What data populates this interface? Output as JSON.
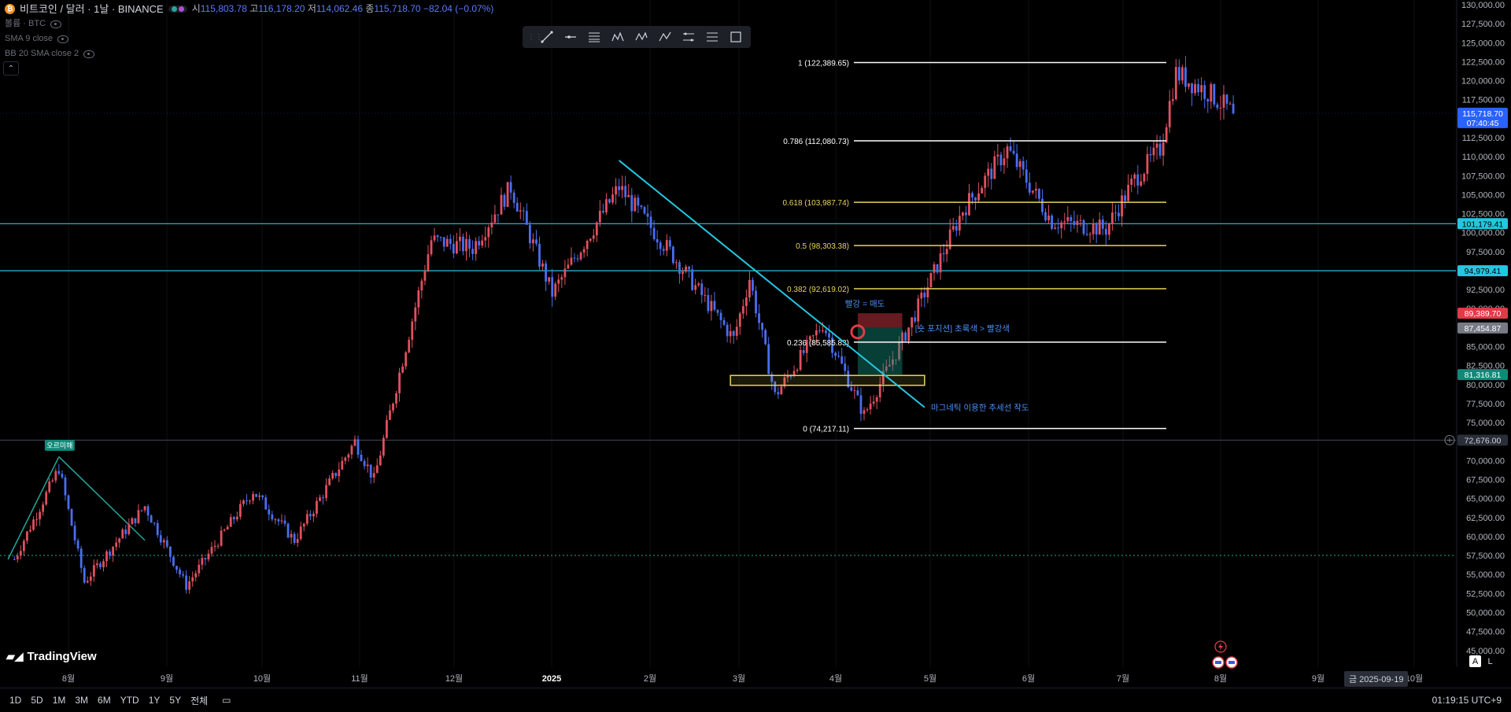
{
  "header": {
    "symbol_title": "비트코인 / 달러 · 1날 · BINANCE",
    "ohlc": [
      {
        "k": "시",
        "v": "115,803.78"
      },
      {
        "k": "고",
        "v": "116,178.20"
      },
      {
        "k": "저",
        "v": "114,062.46"
      },
      {
        "k": "종",
        "v": "115,718.70"
      }
    ],
    "change": "−82.04 (−0.07%)",
    "sub_label": "볼륨 · BTC",
    "indicators": [
      "SMA 9 close",
      "BB 20 SMA close 2"
    ]
  },
  "colors": {
    "bull": "#e05060",
    "bear": "#4a6ef0",
    "cyan": "#25c6e0",
    "fib_white": "#ffffff",
    "fib_yellow": "#e8d45a",
    "teal": "#26a69a",
    "annotation_blue": "#4a8ef5"
  },
  "toolbar": {
    "icons": [
      "trend-line-icon",
      "horizontal-ray-icon",
      "fib-retracement-icon",
      "pattern-icon",
      "xabcd-pattern-icon",
      "abcd-pattern-icon",
      "parallel-channel-icon",
      "fib-channel-icon",
      "rectangle-icon"
    ]
  },
  "chart_data": {
    "type": "candlestick",
    "x_ticks": [
      "8월",
      "9월",
      "10월",
      "11월",
      "12월",
      "2025",
      "2월",
      "3월",
      "4월",
      "5월",
      "6월",
      "7월",
      "8월",
      "9월",
      "10월"
    ],
    "y_ticks": [
      "130,000.00",
      "127,500.00",
      "125,000.00",
      "122,500.00",
      "120,000.00",
      "117,500.00",
      "115,000.00",
      "112,500.00",
      "110,000.00",
      "107,500.00",
      "105,000.00",
      "102,500.00",
      "100,000.00",
      "97,500.00",
      "95,000.00",
      "92,500.00",
      "90,000.00",
      "87,500.00",
      "85,000.00",
      "82,500.00",
      "80,000.00",
      "77,500.00",
      "75,000.00",
      "72,500.00",
      "70,000.00",
      "67,500.00",
      "65,000.00",
      "62,500.00",
      "60,000.00",
      "57,500.00",
      "55,000.00",
      "52,500.00",
      "50,000.00",
      "47,500.00",
      "45,000.00"
    ],
    "ylim": [
      43500,
      131000
    ],
    "price_path": [
      {
        "date": "2024-07-14",
        "price": 57000
      },
      {
        "date": "2024-07-28",
        "price": 69000
      },
      {
        "date": "2024-08-05",
        "price": 54000
      },
      {
        "date": "2024-08-24",
        "price": 64000
      },
      {
        "date": "2024-09-06",
        "price": 53500
      },
      {
        "date": "2024-09-27",
        "price": 66000
      },
      {
        "date": "2024-10-10",
        "price": 59500
      },
      {
        "date": "2024-10-29",
        "price": 72500
      },
      {
        "date": "2024-11-04",
        "price": 67500
      },
      {
        "date": "2024-11-22",
        "price": 99000
      },
      {
        "date": "2024-12-05",
        "price": 98000
      },
      {
        "date": "2024-12-17",
        "price": 106000
      },
      {
        "date": "2024-12-30",
        "price": 92000
      },
      {
        "date": "2025-01-20",
        "price": 106000
      },
      {
        "date": "2025-02-05",
        "price": 97500
      },
      {
        "date": "2025-02-25",
        "price": 86000
      },
      {
        "date": "2025-03-02",
        "price": 94000
      },
      {
        "date": "2025-03-10",
        "price": 78500
      },
      {
        "date": "2025-03-25",
        "price": 88000
      },
      {
        "date": "2025-04-07",
        "price": 76000
      },
      {
        "date": "2025-04-21",
        "price": 87500
      },
      {
        "date": "2025-05-08",
        "price": 103000
      },
      {
        "date": "2025-05-22",
        "price": 111000
      },
      {
        "date": "2025-06-05",
        "price": 101500
      },
      {
        "date": "2025-06-22",
        "price": 100500
      },
      {
        "date": "2025-07-01",
        "price": 107000
      },
      {
        "date": "2025-07-09",
        "price": 111000
      },
      {
        "date": "2025-07-14",
        "price": 121000
      },
      {
        "date": "2025-07-24",
        "price": 118500
      },
      {
        "date": "2025-08-01",
        "price": 115700
      }
    ],
    "horizontal_lines": [
      {
        "price": 101179.41,
        "label": "101,179.41",
        "color": "#25c6e0"
      },
      {
        "price": 94979.41,
        "label": "94,979.41",
        "color": "#25c6e0"
      },
      {
        "price": 72676.0,
        "label": "72,676.00",
        "color": "#3a3f4b"
      }
    ],
    "dotted_line": {
      "price": 57500
    },
    "price_labels": [
      {
        "price": 115718.7,
        "label": "115,718.70",
        "sub": "07:40:45",
        "color": "#2962ff"
      },
      {
        "price": 89389.7,
        "label": "89,389.70",
        "color": "#e03b46"
      },
      {
        "price": 87454.87,
        "label": "87,454.87",
        "color": "#787b86"
      },
      {
        "price": 81316.81,
        "label": "81,316.81",
        "color": "#0f8a78"
      }
    ],
    "fib": {
      "start_date": "2025-04-07",
      "end_date": "2025-07-14",
      "levels": [
        {
          "ratio": "1",
          "price": 122389.65,
          "label": "1 (122,389.65)",
          "color": "#ffffff"
        },
        {
          "ratio": "0.786",
          "price": 112080.73,
          "label": "0.786 (112,080.73)",
          "color": "#ffffff"
        },
        {
          "ratio": "0.618",
          "price": 103987.74,
          "label": "0.618 (103,987.74)",
          "color": "#e8d45a"
        },
        {
          "ratio": "0.5",
          "price": 98303.38,
          "label": "0.5 (98,303.38)",
          "color": "#e8d45a"
        },
        {
          "ratio": "0.382",
          "price": 92619.02,
          "label": "0.382 (92,619.02)",
          "color": "#e8d45a"
        },
        {
          "ratio": "0.236",
          "price": 85585.83,
          "label": "0.236 (85,585.83)",
          "color": "#ffffff"
        },
        {
          "ratio": "0",
          "price": 74217.11,
          "label": "0 (74,217.11)",
          "color": "#ffffff"
        }
      ]
    },
    "trendline": {
      "from": {
        "date": "2025-01-20",
        "price": 109500
      },
      "to": {
        "date": "2025-04-26",
        "price": 77000
      }
    },
    "zone": {
      "from_date": "2025-02-24",
      "to_date": "2025-04-26",
      "top": 81200,
      "bottom": 79900
    },
    "position": {
      "from_date": "2025-04-05",
      "to_date": "2025-04-19",
      "entry": 87454.87,
      "stop": 89389.7,
      "target": 81316.81
    },
    "uptrend_lines": [
      {
        "from": {
          "date": "2024-07-12",
          "price": 57000
        },
        "to": {
          "date": "2024-07-28",
          "price": 70500
        }
      },
      {
        "from": {
          "date": "2024-07-28",
          "price": 70500
        },
        "to": {
          "date": "2024-08-24",
          "price": 59500
        }
      }
    ],
    "annotations": [
      {
        "text": "빨강 = 매도",
        "date": "2025-04-01",
        "price": 90300
      },
      {
        "text": "[숏 포지션] 초록색 > 빨강색",
        "date": "2025-04-23",
        "price": 87000
      },
      {
        "text": "마그네틱 이용한 추세선 작도",
        "date": "2025-04-28",
        "price": 76600
      }
    ],
    "badge": {
      "text": "오르미해",
      "date": "2024-07-28",
      "price": 71800
    },
    "cursor_date": "금 2025-09-19"
  },
  "bottom_bar": {
    "ranges": [
      "1D",
      "5D",
      "1M",
      "3M",
      "6M",
      "YTD",
      "1Y",
      "5Y",
      "전체"
    ],
    "time": "01:19:15 UTC+9"
  },
  "brand": "TradingView",
  "al_buttons": [
    "A",
    "L"
  ]
}
